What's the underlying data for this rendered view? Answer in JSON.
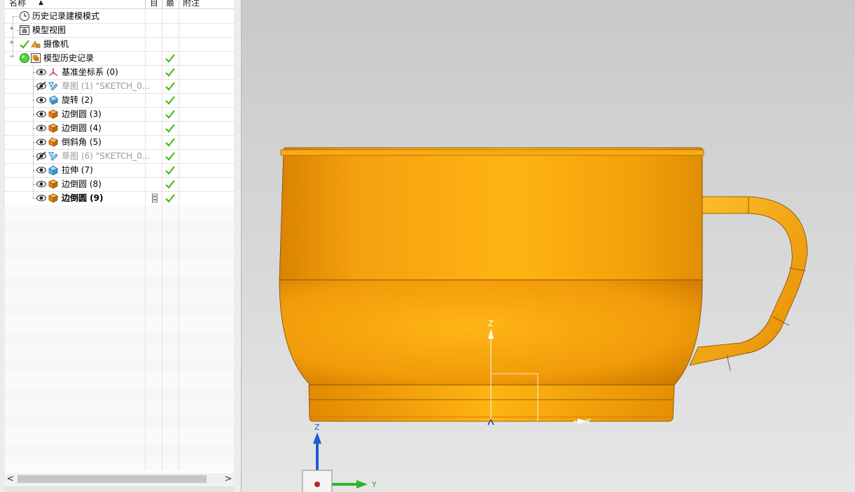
{
  "navigator": {
    "columns": {
      "name": "名称",
      "col2": "目",
      "col3": "最",
      "notes": "附注"
    },
    "items": [
      {
        "label": "历史记录建模模式"
      },
      {
        "label": "模型视图"
      },
      {
        "label": "摄像机"
      },
      {
        "label": "模型历史记录"
      },
      {
        "label": "基准坐标系 (0)"
      },
      {
        "label": "草图 (1) \"SKETCH_0..."
      },
      {
        "label": "旋转 (2)"
      },
      {
        "label": "边倒圆 (3)"
      },
      {
        "label": "边倒圆 (4)"
      },
      {
        "label": "倒斜角 (5)"
      },
      {
        "label": "草图 (6) \"SKETCH_0..."
      },
      {
        "label": "拉伸 (7)"
      },
      {
        "label": "边倒圆 (8)"
      },
      {
        "label": "边倒圆 (9)"
      }
    ],
    "scroll_left": "<",
    "scroll_right": ">"
  },
  "viewport": {
    "datum_axis_z": "Z",
    "datum_axis_y": "Y",
    "triad_z": "Z",
    "triad_y": "Y"
  },
  "colors": {
    "part_orange": "#f5a00e",
    "check_green": "#3bb800",
    "triad_blue": "#1a5ed6",
    "triad_green": "#2bb52b"
  }
}
